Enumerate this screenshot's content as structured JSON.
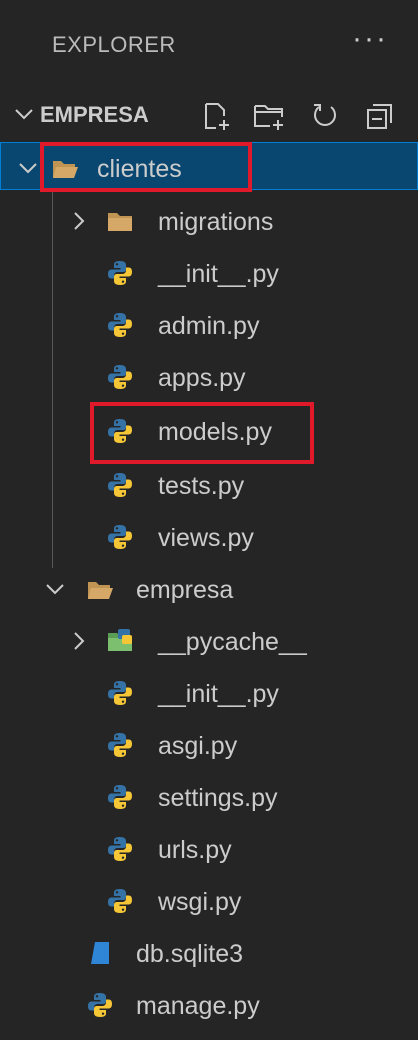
{
  "explorer": {
    "title": "EXPLORER",
    "more_label": "···",
    "root": {
      "label": "EMPRESA",
      "actions": [
        "new-file-icon",
        "new-folder-icon",
        "refresh-icon",
        "collapse-all-icon"
      ]
    },
    "tree": [
      {
        "label": "clientes",
        "kind": "folder-open",
        "expanded": true,
        "selected": true,
        "highlighted": true
      },
      {
        "label": "migrations",
        "kind": "folder",
        "expanded": false
      },
      {
        "label": "__init__.py",
        "kind": "python"
      },
      {
        "label": "admin.py",
        "kind": "python"
      },
      {
        "label": "apps.py",
        "kind": "python"
      },
      {
        "label": "models.py",
        "kind": "python",
        "highlighted": true
      },
      {
        "label": "tests.py",
        "kind": "python"
      },
      {
        "label": "views.py",
        "kind": "python"
      },
      {
        "label": "empresa",
        "kind": "folder-open",
        "expanded": true
      },
      {
        "label": "__pycache__",
        "kind": "folder-special",
        "expanded": false
      },
      {
        "label": "__init__.py",
        "kind": "python"
      },
      {
        "label": "asgi.py",
        "kind": "python"
      },
      {
        "label": "settings.py",
        "kind": "python"
      },
      {
        "label": "urls.py",
        "kind": "python"
      },
      {
        "label": "wsgi.py",
        "kind": "python"
      },
      {
        "label": "db.sqlite3",
        "kind": "database"
      },
      {
        "label": "manage.py",
        "kind": "python"
      }
    ]
  },
  "colors": {
    "panel_bg": "#252526",
    "selected_bg": "#094771",
    "selected_border": "#007fd4",
    "text": "#cccccc",
    "highlight": "#e01a2b",
    "folder": "#c09553",
    "python_blue": "#3572a5",
    "python_yellow": "#f5c737",
    "database": "#2f86d6"
  }
}
